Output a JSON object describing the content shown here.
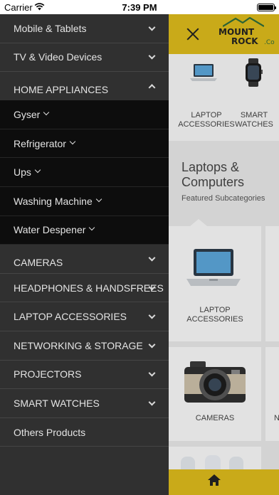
{
  "status_bar": {
    "carrier": "Carrier",
    "time": "7:39 PM",
    "battery_level": 1.0
  },
  "drawer": {
    "items": [
      {
        "label": "Mobile & Tablets",
        "chevron": "down"
      },
      {
        "label": "TV & Video Devices",
        "chevron": "down"
      },
      {
        "label": "HOME APPLIANCES",
        "chevron": "up"
      }
    ],
    "subitems": [
      {
        "label": "Gyser"
      },
      {
        "label": "Refrigerator"
      },
      {
        "label": "Ups"
      },
      {
        "label": "Washing Machine"
      },
      {
        "label": "Water Despener"
      }
    ],
    "more_items": [
      {
        "label": "CAMERAS",
        "chevron": "down"
      },
      {
        "label": "HEADPHONES & HANDSFREES",
        "chevron": "down"
      },
      {
        "label": "LAPTOP ACCESSORIES",
        "chevron": "down"
      },
      {
        "label": "NETWORKING & STORAGE",
        "chevron": "down"
      },
      {
        "label": "PROJECTORS",
        "chevron": "down"
      },
      {
        "label": "SMART WATCHES",
        "chevron": "down"
      },
      {
        "label": "Others Products",
        "chevron": ""
      }
    ]
  },
  "main": {
    "logo": {
      "line1": "MOUNT",
      "line2": "ROCK",
      "suffix": ".Co"
    },
    "featured": [
      {
        "label_line1": "LAPTOP",
        "label_line2": "ACCESSORIES",
        "icon": "laptop-icon"
      },
      {
        "label_line1": "SMART",
        "label_line2": "WATCHES",
        "icon": "smartwatch-icon"
      }
    ],
    "section": {
      "title_line1": "Laptops &",
      "title_line2": "Computers",
      "subtitle": "Featured Subcategories"
    },
    "tiles": [
      {
        "label_line1": "LAPTOP",
        "label_line2": "ACCESSORIES",
        "icon": "laptop-icon"
      },
      {
        "label_line1": "CAMERAS",
        "label_line2": "",
        "icon": "camera-icon"
      }
    ],
    "tile_partial_label": "N",
    "bottom_icon": "home-icon"
  },
  "colors": {
    "drawer_bg": "#303030",
    "submenu_bg": "#0d0d0d",
    "accent": "#d9b71b"
  }
}
